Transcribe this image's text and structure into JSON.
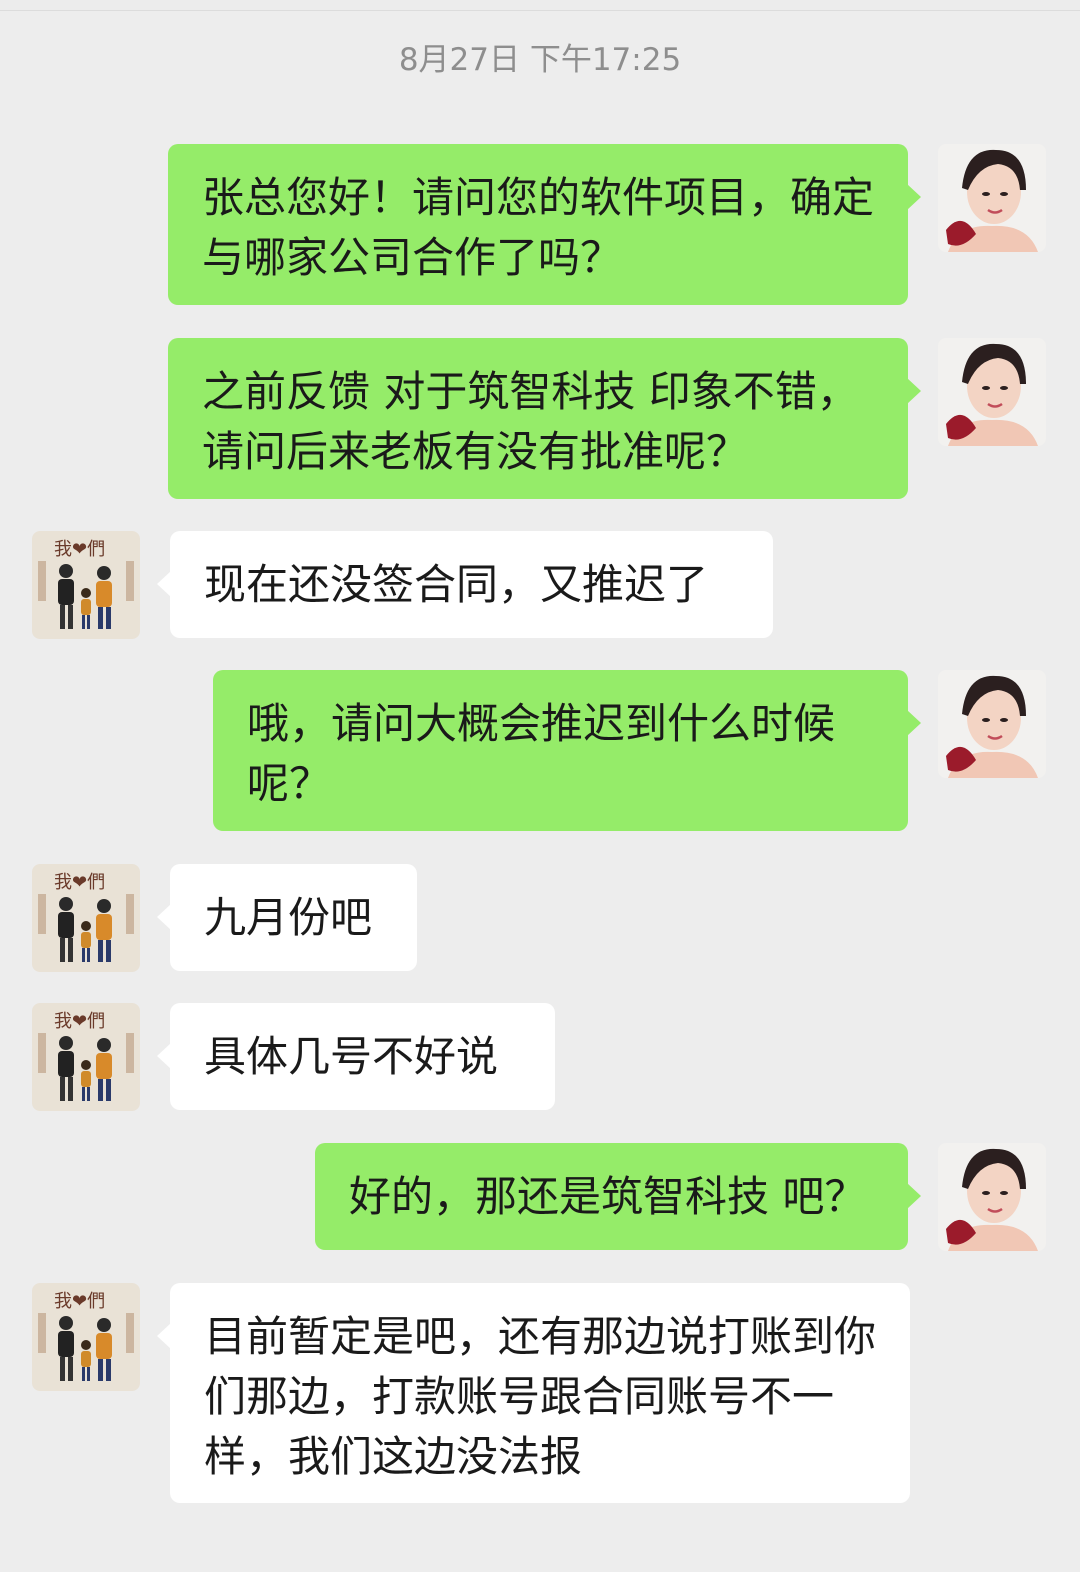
{
  "timestamp": "8月27日 下午17:25",
  "colors": {
    "background": "#ededed",
    "sent_bubble": "#95ec69",
    "received_bubble": "#ffffff",
    "timestamp_text": "#8e8e8e"
  },
  "messages": [
    {
      "sender": "self",
      "text": "张总您好！请问您的软件项目，确定与哪家公司合作了吗？"
    },
    {
      "sender": "self",
      "text": "之前反馈 对于筑智科技 印象不错，请问后来老板有没有批准呢？"
    },
    {
      "sender": "other",
      "text": "现在还没签合同，又推迟了"
    },
    {
      "sender": "self",
      "text": "哦，请问大概会推迟到什么时候呢？"
    },
    {
      "sender": "other",
      "text": "九月份吧"
    },
    {
      "sender": "other",
      "text": "具体几号不好说"
    },
    {
      "sender": "self",
      "text": "好的，那还是筑智科技 吧？"
    },
    {
      "sender": "other",
      "text": "目前暂定是吧，还有那边说打账到你们那边，打款账号跟合同账号不一样，我们这边没法报"
    }
  ],
  "avatars": {
    "self": "woman-portrait-avatar",
    "other": "couple-poster-avatar",
    "other_logo_text": "我❤們"
  }
}
